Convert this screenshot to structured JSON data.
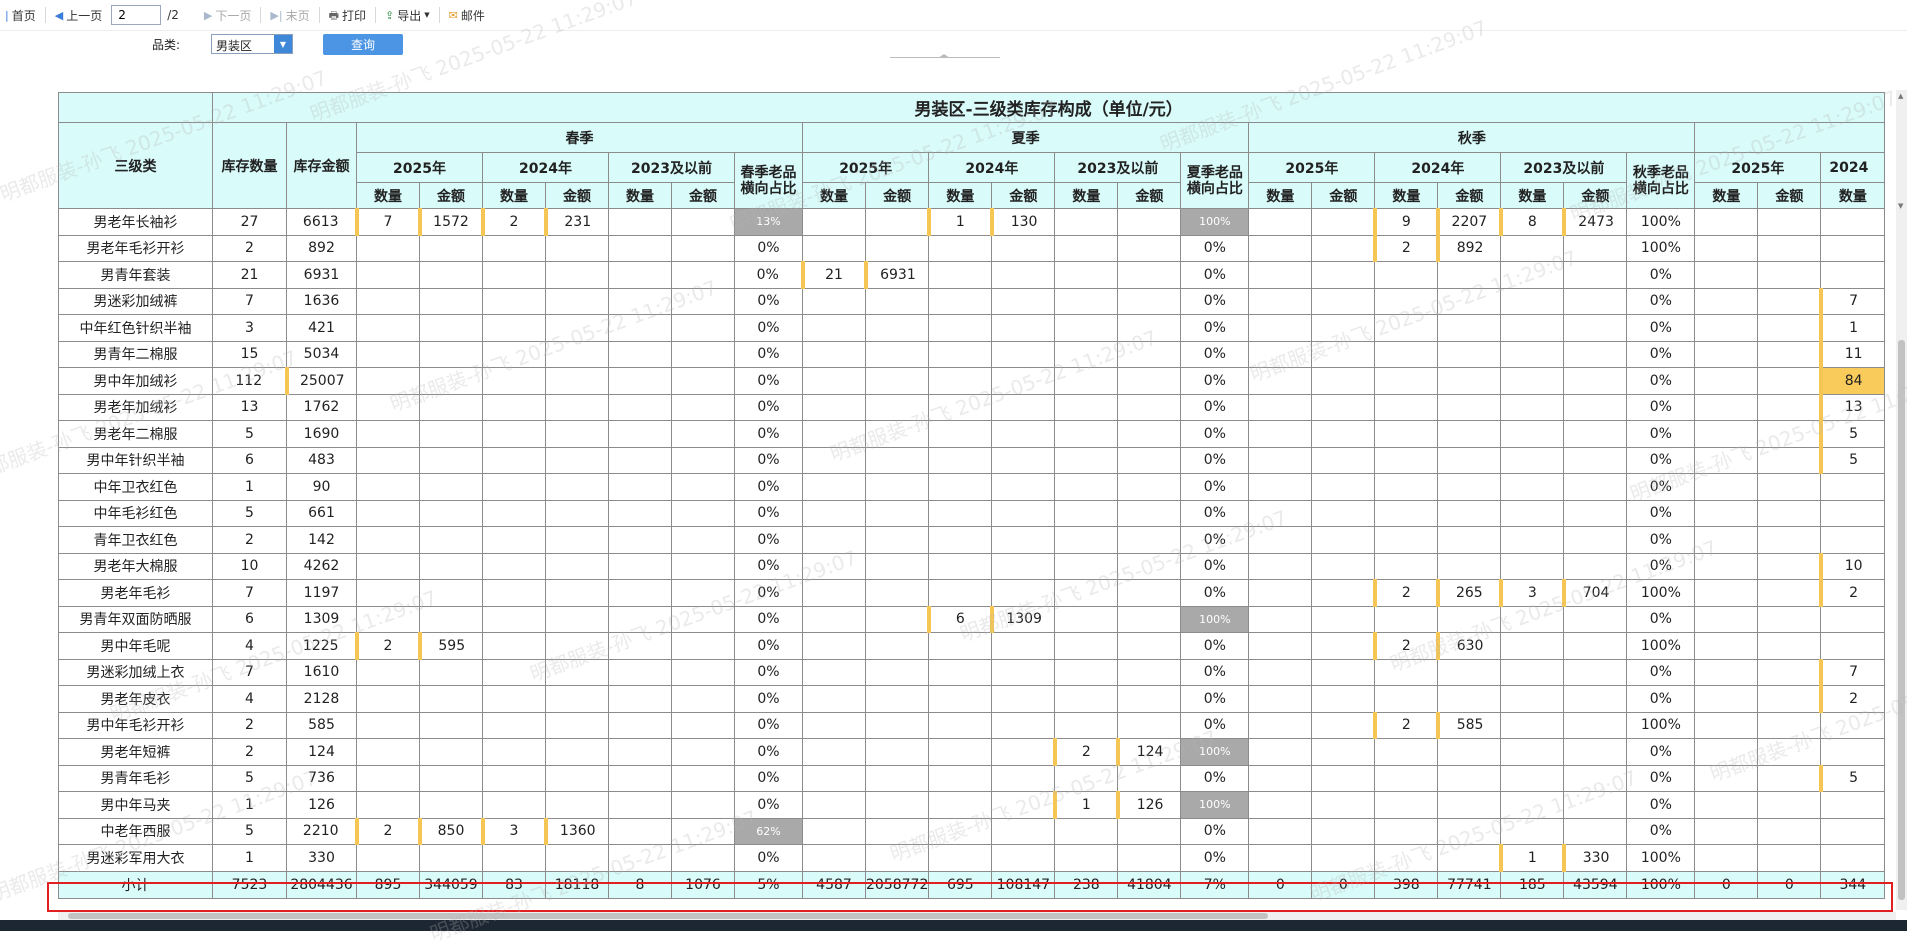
{
  "toolbar": {
    "first": "首页",
    "prev": "上一页",
    "page_value": "2",
    "page_total": "/2",
    "next": "下一页",
    "last": "末页",
    "print": "打印",
    "export": "导出",
    "mail": "邮件"
  },
  "filter": {
    "label": "品类:",
    "category_value": "男装区",
    "query": "查询"
  },
  "report": {
    "title": "男装区-三级类库存构成（单位/元）",
    "col_category": "三级类",
    "col_stock_qty": "库存数量",
    "col_stock_amt": "库存金额",
    "seasons": [
      "春季",
      "夏季",
      "秋季"
    ],
    "years": [
      "2025年",
      "2024年",
      "2023及以前"
    ],
    "qty": "数量",
    "amt": "金额",
    "ratio_labels": [
      "春季老品横向占比",
      "夏季老品横向占比",
      "秋季老品横向占比"
    ],
    "next_year_2025": "2025年",
    "next_year_2024_partial": "2024",
    "rows": [
      [
        "男老年长袖衫",
        "27",
        "6613",
        "7",
        "1572",
        "2",
        "231",
        "",
        "",
        "13%",
        "",
        "",
        "1",
        "130",
        "",
        "",
        "100%",
        "",
        "",
        "9",
        "2207",
        "8",
        "2473",
        "100%",
        "",
        "",
        ""
      ],
      [
        "男老年毛衫开衫",
        "2",
        "892",
        "",
        "",
        "",
        "",
        "",
        "",
        "0%",
        "",
        "",
        "",
        "",
        "",
        "",
        "0%",
        "",
        "",
        "2",
        "892",
        "",
        "",
        "100%",
        "",
        "",
        ""
      ],
      [
        "男青年套装",
        "21",
        "6931",
        "",
        "",
        "",
        "",
        "",
        "",
        "0%",
        "21",
        "6931",
        "",
        "",
        "",
        "",
        "0%",
        "",
        "",
        "",
        "",
        "",
        "",
        "0%",
        "",
        "",
        ""
      ],
      [
        "男迷彩加绒裤",
        "7",
        "1636",
        "",
        "",
        "",
        "",
        "",
        "",
        "0%",
        "",
        "",
        "",
        "",
        "",
        "",
        "0%",
        "",
        "",
        "",
        "",
        "",
        "",
        "0%",
        "",
        "",
        "7"
      ],
      [
        "中年红色针织半袖",
        "3",
        "421",
        "",
        "",
        "",
        "",
        "",
        "",
        "0%",
        "",
        "",
        "",
        "",
        "",
        "",
        "0%",
        "",
        "",
        "",
        "",
        "",
        "",
        "0%",
        "",
        "",
        "1"
      ],
      [
        "男青年二棉服",
        "15",
        "5034",
        "",
        "",
        "",
        "",
        "",
        "",
        "0%",
        "",
        "",
        "",
        "",
        "",
        "",
        "0%",
        "",
        "",
        "",
        "",
        "",
        "",
        "0%",
        "",
        "",
        "11"
      ],
      [
        "男中年加绒衫",
        "112",
        "25007",
        "",
        "",
        "",
        "",
        "",
        "",
        "0%",
        "",
        "",
        "",
        "",
        "",
        "",
        "0%",
        "",
        "",
        "",
        "",
        "",
        "",
        "0%",
        "",
        "",
        "84"
      ],
      [
        "男老年加绒衫",
        "13",
        "1762",
        "",
        "",
        "",
        "",
        "",
        "",
        "0%",
        "",
        "",
        "",
        "",
        "",
        "",
        "0%",
        "",
        "",
        "",
        "",
        "",
        "",
        "0%",
        "",
        "",
        "13"
      ],
      [
        "男老年二棉服",
        "5",
        "1690",
        "",
        "",
        "",
        "",
        "",
        "",
        "0%",
        "",
        "",
        "",
        "",
        "",
        "",
        "0%",
        "",
        "",
        "",
        "",
        "",
        "",
        "0%",
        "",
        "",
        "5"
      ],
      [
        "男中年针织半袖",
        "6",
        "483",
        "",
        "",
        "",
        "",
        "",
        "",
        "0%",
        "",
        "",
        "",
        "",
        "",
        "",
        "0%",
        "",
        "",
        "",
        "",
        "",
        "",
        "0%",
        "",
        "",
        "5"
      ],
      [
        "中年卫衣红色",
        "1",
        "90",
        "",
        "",
        "",
        "",
        "",
        "",
        "0%",
        "",
        "",
        "",
        "",
        "",
        "",
        "0%",
        "",
        "",
        "",
        "",
        "",
        "",
        "0%",
        "",
        "",
        ""
      ],
      [
        "中年毛衫红色",
        "5",
        "661",
        "",
        "",
        "",
        "",
        "",
        "",
        "0%",
        "",
        "",
        "",
        "",
        "",
        "",
        "0%",
        "",
        "",
        "",
        "",
        "",
        "",
        "0%",
        "",
        "",
        ""
      ],
      [
        "青年卫衣红色",
        "2",
        "142",
        "",
        "",
        "",
        "",
        "",
        "",
        "0%",
        "",
        "",
        "",
        "",
        "",
        "",
        "0%",
        "",
        "",
        "",
        "",
        "",
        "",
        "0%",
        "",
        "",
        ""
      ],
      [
        "男老年大棉服",
        "10",
        "4262",
        "",
        "",
        "",
        "",
        "",
        "",
        "0%",
        "",
        "",
        "",
        "",
        "",
        "",
        "0%",
        "",
        "",
        "",
        "",
        "",
        "",
        "0%",
        "",
        "",
        "10"
      ],
      [
        "男老年毛衫",
        "7",
        "1197",
        "",
        "",
        "",
        "",
        "",
        "",
        "0%",
        "",
        "",
        "",
        "",
        "",
        "",
        "0%",
        "",
        "",
        "2",
        "265",
        "3",
        "704",
        "100%",
        "",
        "",
        "2"
      ],
      [
        "男青年双面防晒服",
        "6",
        "1309",
        "",
        "",
        "",
        "",
        "",
        "",
        "0%",
        "",
        "",
        "6",
        "1309",
        "",
        "",
        "100%",
        "",
        "",
        "",
        "",
        "",
        "",
        "0%",
        "",
        "",
        ""
      ],
      [
        "男中年毛呢",
        "4",
        "1225",
        "2",
        "595",
        "",
        "",
        "",
        "",
        "0%",
        "",
        "",
        "",
        "",
        "",
        "",
        "0%",
        "",
        "",
        "2",
        "630",
        "",
        "",
        "100%",
        "",
        "",
        ""
      ],
      [
        "男迷彩加绒上衣",
        "7",
        "1610",
        "",
        "",
        "",
        "",
        "",
        "",
        "0%",
        "",
        "",
        "",
        "",
        "",
        "",
        "0%",
        "",
        "",
        "",
        "",
        "",
        "",
        "0%",
        "",
        "",
        "7"
      ],
      [
        "男老年皮衣",
        "4",
        "2128",
        "",
        "",
        "",
        "",
        "",
        "",
        "0%",
        "",
        "",
        "",
        "",
        "",
        "",
        "0%",
        "",
        "",
        "",
        "",
        "",
        "",
        "0%",
        "",
        "",
        "2"
      ],
      [
        "男中年毛衫开衫",
        "2",
        "585",
        "",
        "",
        "",
        "",
        "",
        "",
        "0%",
        "",
        "",
        "",
        "",
        "",
        "",
        "0%",
        "",
        "",
        "2",
        "585",
        "",
        "",
        "100%",
        "",
        "",
        ""
      ],
      [
        "男老年短裤",
        "2",
        "124",
        "",
        "",
        "",
        "",
        "",
        "",
        "0%",
        "",
        "",
        "",
        "",
        "2",
        "124",
        "100%",
        "",
        "",
        "",
        "",
        "",
        "",
        "0%",
        "",
        "",
        ""
      ],
      [
        "男青年毛衫",
        "5",
        "736",
        "",
        "",
        "",
        "",
        "",
        "",
        "0%",
        "",
        "",
        "",
        "",
        "",
        "",
        "0%",
        "",
        "",
        "",
        "",
        "",
        "",
        "0%",
        "",
        "",
        "5"
      ],
      [
        "男中年马夹",
        "1",
        "126",
        "",
        "",
        "",
        "",
        "",
        "",
        "0%",
        "",
        "",
        "",
        "",
        "1",
        "126",
        "100%",
        "",
        "",
        "",
        "",
        "",
        "",
        "0%",
        "",
        "",
        ""
      ],
      [
        "中老年西服",
        "5",
        "2210",
        "2",
        "850",
        "3",
        "1360",
        "",
        "",
        "62%",
        "",
        "",
        "",
        "",
        "",
        "",
        "0%",
        "",
        "",
        "",
        "",
        "",
        "",
        "0%",
        "",
        "",
        ""
      ],
      [
        "男迷彩军用大衣",
        "1",
        "330",
        "",
        "",
        "",
        "",
        "",
        "",
        "0%",
        "",
        "",
        "",
        "",
        "",
        "",
        "0%",
        "",
        "",
        "",
        "",
        "1",
        "330",
        "100%",
        "",
        "",
        ""
      ]
    ],
    "subtotal": [
      "小计",
      "7523",
      "2804436",
      "895",
      "344059",
      "83",
      "18118",
      "8",
      "1076",
      "5%",
      "4587",
      "2058772",
      "695",
      "108147",
      "238",
      "41804",
      "7%",
      "0",
      "0",
      "398",
      "77741",
      "185",
      "43594",
      "100%",
      "0",
      "0",
      "344"
    ]
  },
  "watermark": "明都服装-孙飞 2025-05-22 11:29:07"
}
